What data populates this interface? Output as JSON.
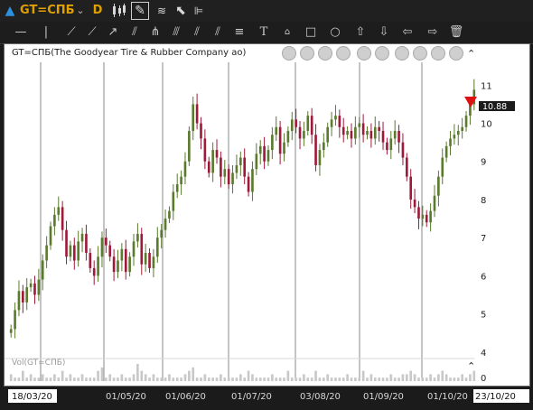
{
  "header": {
    "symbol": "GT=СПБ",
    "period": "D"
  },
  "chart_title": "GT=СПБ(The Goodyear Tire & Rubber Company ао)",
  "volume_label": "Vol(GT=СПБ)",
  "icons": {
    "toolbar1": [
      "triangle-up-icon",
      "chevron-down-icon",
      "candlestick-icon",
      "pencil-icon",
      "indicator-icon",
      "cursor-icon",
      "settings-icon"
    ],
    "toolbar2": [
      "cursor-line-icon",
      "vertical-line-icon",
      "trend-line-icon",
      "ray-icon",
      "arrow-line-icon",
      "channel-icon",
      "pitchfork-icon",
      "gann-fan-icon",
      "fibonacci-icon",
      "text-icon",
      "price-label-icon",
      "rectangle-icon",
      "ellipse-icon",
      "arrow-up-icon",
      "arrow-down-icon",
      "arrow-left-icon",
      "arrow-right-icon",
      "trash-icon"
    ],
    "nav": [
      "rewind-fast-icon",
      "step-back-icon",
      "step-forward-icon",
      "forward-fast-icon",
      "zoom-in-icon",
      "zoom-out-icon",
      "zoom-fit-icon",
      "compress-icon",
      "expand-icon",
      "go-end-icon"
    ]
  },
  "colors": {
    "up_candle": "#5a7a2e",
    "down_candle": "#9e1a3a",
    "last_price_marker": "#e01010",
    "accent_symbol": "#e0a000"
  },
  "chart_data": {
    "type": "candlestick",
    "title": "GT=СПБ(The Goodyear Tire & Rubber Company ао)",
    "y_ticks": [
      4,
      5,
      6,
      7,
      8,
      9,
      10,
      11
    ],
    "ylim": [
      3.9,
      11.6
    ],
    "volume_ticks": [
      0
    ],
    "x_labels": [
      "01/05/20",
      "01/06/20",
      "01/07/20",
      "03/08/20",
      "01/09/20",
      "01/10/20"
    ],
    "start_date_label": "18/03/20",
    "end_date_label": "23/10/20",
    "last_price": 10.88,
    "approx_close_series": [
      4.6,
      5.1,
      5.6,
      5.3,
      5.7,
      5.8,
      5.5,
      5.9,
      6.4,
      6.8,
      7.3,
      7.6,
      7.8,
      7.2,
      6.5,
      6.8,
      6.4,
      6.9,
      7.1,
      6.6,
      6.2,
      6.0,
      6.5,
      7.0,
      6.8,
      6.5,
      6.1,
      6.4,
      6.7,
      6.1,
      6.5,
      6.9,
      7.1,
      6.3,
      6.6,
      6.2,
      6.5,
      7.0,
      7.2,
      7.5,
      7.7,
      8.2,
      8.4,
      8.6,
      9.0,
      9.8,
      10.5,
      10.0,
      9.6,
      9.0,
      8.7,
      9.3,
      9.1,
      8.6,
      8.8,
      8.4,
      8.7,
      8.9,
      9.1,
      8.6,
      8.2,
      8.8,
      9.2,
      9.4,
      9.0,
      9.3,
      9.7,
      9.9,
      9.2,
      9.5,
      9.8,
      10.1,
      9.9,
      9.6,
      9.8,
      10.2,
      9.7,
      8.9,
      9.3,
      9.5,
      9.9,
      10.1,
      10.2,
      9.9,
      9.7,
      9.8,
      9.6,
      9.9,
      10.0,
      9.7,
      9.8,
      9.6,
      9.9,
      9.8,
      9.5,
      9.3,
      9.6,
      9.8,
      9.5,
      9.1,
      8.6,
      8.0,
      7.8,
      7.5,
      7.6,
      7.4,
      7.7,
      8.1,
      8.6,
      9.1,
      9.4,
      9.6,
      9.7,
      9.8,
      9.9,
      10.2,
      10.5,
      10.88
    ],
    "approx_volume_series": [
      2,
      1,
      1,
      3,
      1,
      2,
      1,
      1,
      2,
      1,
      1,
      2,
      1,
      3,
      1,
      2,
      1,
      1,
      2,
      1,
      1,
      1,
      3,
      4,
      1,
      2,
      1,
      1,
      2,
      1,
      1,
      2,
      5,
      3,
      2,
      1,
      2,
      1,
      1,
      1,
      2,
      1,
      1,
      1,
      2,
      3,
      4,
      1,
      1,
      2,
      1,
      1,
      1,
      2,
      1,
      1,
      1,
      1,
      2,
      1,
      3,
      2,
      1,
      1,
      1,
      1,
      2,
      1,
      1,
      1,
      3,
      1,
      1,
      1,
      2,
      1,
      1,
      3,
      1,
      1,
      2,
      1,
      1,
      1,
      1,
      2,
      1,
      1,
      1,
      3,
      1,
      2,
      1,
      1,
      1,
      1,
      2,
      1,
      1,
      2,
      2,
      3,
      2,
      1,
      1,
      1,
      2,
      1,
      2,
      3,
      2,
      1,
      1,
      1,
      2,
      1,
      2,
      3
    ]
  }
}
